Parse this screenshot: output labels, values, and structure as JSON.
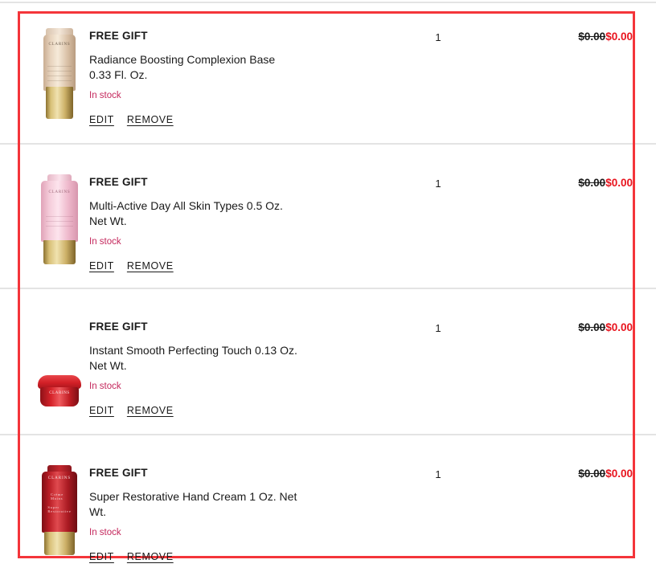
{
  "theme": {
    "highlight_border_color": "#f4353a",
    "separator_color": "#e4e4e4",
    "stock_text_color": "#c4275c",
    "sale_price_color": "#e8141e",
    "text_color": "#1a1a1a"
  },
  "cart": {
    "rows": [
      {
        "gift_label": "FREE GIFT",
        "product_name": "Radiance Boosting Complexion Base 0.33 Fl. Oz.",
        "stock_status": "In stock",
        "edit_label": "EDIT",
        "remove_label": "REMOVE",
        "qty": "1",
        "price_original": "$0.00",
        "price_current": "$0.00",
        "image": "product-thumbnail-radiance-boosting-complexion-base"
      },
      {
        "gift_label": "FREE GIFT",
        "product_name": "Multi-Active Day All Skin Types 0.5 Oz. Net Wt.",
        "stock_status": "In stock",
        "edit_label": "EDIT",
        "remove_label": "REMOVE",
        "qty": "1",
        "price_original": "$0.00",
        "price_current": "$0.00",
        "image": "product-thumbnail-multi-active-day"
      },
      {
        "gift_label": "FREE GIFT",
        "product_name": "Instant Smooth Perfecting Touch 0.13 Oz. Net Wt.",
        "stock_status": "In stock",
        "edit_label": "EDIT",
        "remove_label": "REMOVE",
        "qty": "1",
        "price_original": "$0.00",
        "price_current": "$0.00",
        "image": "product-thumbnail-instant-smooth-perfecting-touch"
      },
      {
        "gift_label": "FREE GIFT",
        "product_name": "Super Restorative Hand Cream 1 Oz. Net Wt.",
        "stock_status": "In stock",
        "edit_label": "EDIT",
        "remove_label": "REMOVE",
        "qty": "1",
        "price_original": "$0.00",
        "price_current": "$0.00",
        "image": "product-thumbnail-super-restorative-hand-cream"
      }
    ],
    "brand_mark": "CLARINS"
  }
}
